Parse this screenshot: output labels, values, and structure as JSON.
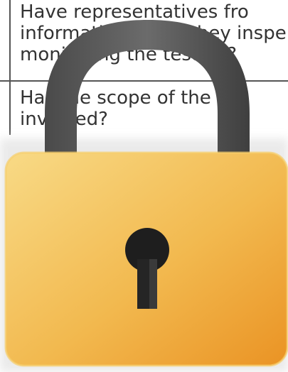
{
  "document": {
    "row1_lines": [
      "Have representatives fro",
      "information, have they inspe",
      "monitoring the testing?"
    ],
    "row2_lines": [
      "Has the scope of the pr",
      "involved?"
    ]
  },
  "overlay": {
    "icon": "padlock-icon",
    "body_color_top": "#F7D57A",
    "body_color_bottom": "#EC9A2A",
    "shackle_color": "#555555",
    "keyhole_color": "#1E1E1E"
  }
}
